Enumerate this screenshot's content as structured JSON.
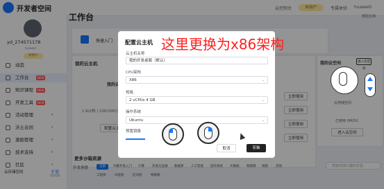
{
  "app": {
    "name": "开发者空间"
  },
  "topbar": {
    "links": [
      "云控制台",
      "专属体验",
      "huawei0"
    ],
    "vip_badge": "新用户"
  },
  "user": {
    "name": "yd_274571178",
    "sub": "huawei",
    "badge": "新用户"
  },
  "sidebar": {
    "items": [
      {
        "label": "动态"
      },
      {
        "label": "工作台",
        "hot": "NEW"
      },
      {
        "label": "知识课程",
        "hot": "NEW"
      },
      {
        "label": "开发工具",
        "hot": "NEW"
      },
      {
        "label": "活动管理"
      },
      {
        "label": "沃土云创"
      },
      {
        "label": "激励管理"
      },
      {
        "label": "技术支持"
      },
      {
        "label": "社区"
      }
    ],
    "footer": {
      "label": "云存储空间",
      "action": "扩容",
      "usage": "0/5GB"
    }
  },
  "workbench": {
    "title": "工作台",
    "top_right": "帮助文档",
    "quick_entry": "快速入门",
    "my_cloud_host": "我的云主机",
    "cloud_host_label": "我的云",
    "host_stats": "1.6/2核 | 100/100小时",
    "cloud_space_title": "我的云空间",
    "cloud_space_btn": "进入云空间",
    "cloud_space_icon": "云存储空间",
    "cloud_space_usage": "已使用  0M/5G",
    "configure_btn": "配置云主机",
    "action_buttons": [
      "立即使用",
      "立即使用",
      "立即使用",
      "立即使用"
    ],
    "more_resources_title": "更多沙箱资源",
    "resource_filter_label": "开发场景",
    "resource_tags": [
      "全部",
      "鸿蒙开发入门",
      "计算",
      "开发与运维",
      "数据库",
      "人工智能",
      "操作系统",
      "大数据",
      "物联网",
      "视频",
      "其他"
    ],
    "search_placeholder": "搜索你感兴趣的实验",
    "bottom_tags": [
      "工程师",
      "AI智能",
      "区块链",
      "物联网"
    ]
  },
  "dialog": {
    "title": "配置云主机",
    "fields": [
      {
        "label": "云主机名称",
        "value": "我的开发桌面（默认）"
      },
      {
        "label": "CPU架构",
        "value": "X86"
      },
      {
        "label": "规格",
        "value": "2 vCPUs 4 GB"
      },
      {
        "label": "操作系统",
        "value": "Ubuntu"
      },
      {
        "label": "预置镜像",
        "value": ""
      }
    ],
    "cancel": "取消",
    "install": "安装"
  },
  "annotation": {
    "text": "这里更换为x86架构",
    "color": "#ff1f1f"
  },
  "icons": [
    "mouse-left-click-icon",
    "mouse-right-click-icon",
    "mouse-scroll-icon",
    "cursor-arrow-icon"
  ],
  "colors": {
    "accent": "#1677ff",
    "hot": "#ff5a5a",
    "overlay": "#ff1f1f"
  }
}
